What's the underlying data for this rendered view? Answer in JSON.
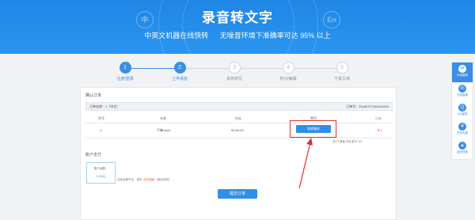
{
  "hero": {
    "title": "录音转文字",
    "subtitle_left": "中英文机器在线快转",
    "subtitle_right": "无噪音环境下准确率可达 95% 以上",
    "bubble_cn": "中",
    "bubble_en": "En"
  },
  "steps": [
    {
      "num": "1",
      "label": "注册/登录"
    },
    {
      "num": "2",
      "label": "上传语音"
    },
    {
      "num": "3",
      "label": "系统转写"
    },
    {
      "num": "4",
      "label": "校对/编辑"
    },
    {
      "num": "5",
      "label": "下载文档"
    }
  ],
  "order": {
    "section_title": "确认订单",
    "order_name": "订单名称：1（中文）",
    "order_no": "订单号：20180727152414434",
    "columns": [
      "序号",
      "名称",
      "时长",
      "费用",
      "小计"
    ],
    "row": {
      "index": "1",
      "name": "干嘛.mp3",
      "duration": "00:00:03",
      "pay_label": "快转服务",
      "subtotal": "￥1"
    },
    "summary_prefix": "共1个录音",
    "summary_mid": "共计支付",
    "summary_amount": "￥2"
  },
  "balance": {
    "section_title": "账户支付",
    "box_title": "账户余额：",
    "box_value": "0.00元",
    "note_prefix": "当前余额不足，请先",
    "note_link": "【去充值】",
    "note_suffix": "（使用说明）",
    "submit_label": "提交订单"
  },
  "sidebar": [
    {
      "icon": "chat-icon",
      "glyph": "✉",
      "label": "在线客服"
    },
    {
      "icon": "headset-icon",
      "glyph": "☏",
      "label": "在线客服"
    },
    {
      "icon": "qq-icon",
      "glyph": "Q",
      "label": "QQ客服"
    },
    {
      "icon": "wechat-icon",
      "glyph": "¥",
      "label": "在线充值"
    },
    {
      "icon": "arrow-up-icon",
      "glyph": "▲",
      "label": "返回顶部"
    }
  ],
  "colors": {
    "accent": "#2f8fe6",
    "highlight": "#e03030"
  }
}
